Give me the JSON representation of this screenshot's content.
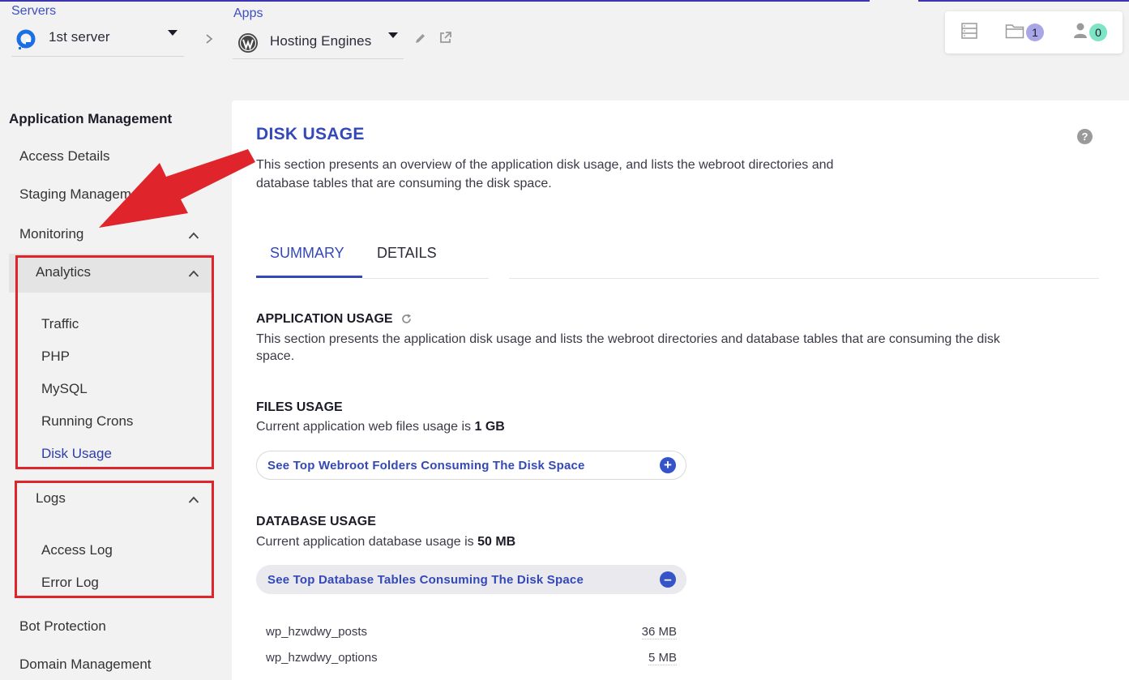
{
  "header": {
    "servers_label": "Servers",
    "server_name": "1st server",
    "apps_label": "Apps",
    "app_name": "Hosting Engines",
    "folder_count": "1",
    "user_count": "0"
  },
  "sidebar": {
    "title": "Application Management",
    "items": {
      "access_details": "Access Details",
      "staging": "Staging Management",
      "monitoring": "Monitoring",
      "analytics": "Analytics",
      "traffic": "Traffic",
      "php": "PHP",
      "mysql": "MySQL",
      "crons": "Running Crons",
      "disk_usage": "Disk Usage",
      "logs": "Logs",
      "access_log": "Access Log",
      "error_log": "Error Log",
      "bot_protection": "Bot Protection",
      "domain_management": "Domain Management"
    }
  },
  "main": {
    "title": "DISK USAGE",
    "description": "This section presents an overview of the application disk usage, and lists the webroot directories and database tables that are consuming the disk space.",
    "tabs": [
      "SUMMARY",
      "DETAILS"
    ],
    "app_usage_heading": "APPLICATION USAGE",
    "app_usage_text": "This section presents the application disk usage and lists the webroot directories and database tables that are consuming the disk space.",
    "files_heading": "FILES USAGE",
    "files_text": "Current application web files usage is",
    "files_value": "1 GB",
    "files_button": "See Top Webroot Folders Consuming The Disk Space",
    "db_heading": "DATABASE USAGE",
    "db_text": "Current application database usage is",
    "db_value": "50 MB",
    "db_button": "See Top Database Tables Consuming The Disk Space",
    "tables": [
      {
        "name": "wp_hzwdwy_posts",
        "size": "36 MB"
      },
      {
        "name": "wp_hzwdwy_options",
        "size": "5 MB"
      }
    ]
  },
  "colors": {
    "accent": "#3448b8",
    "annotation_red": "#e0242b"
  }
}
